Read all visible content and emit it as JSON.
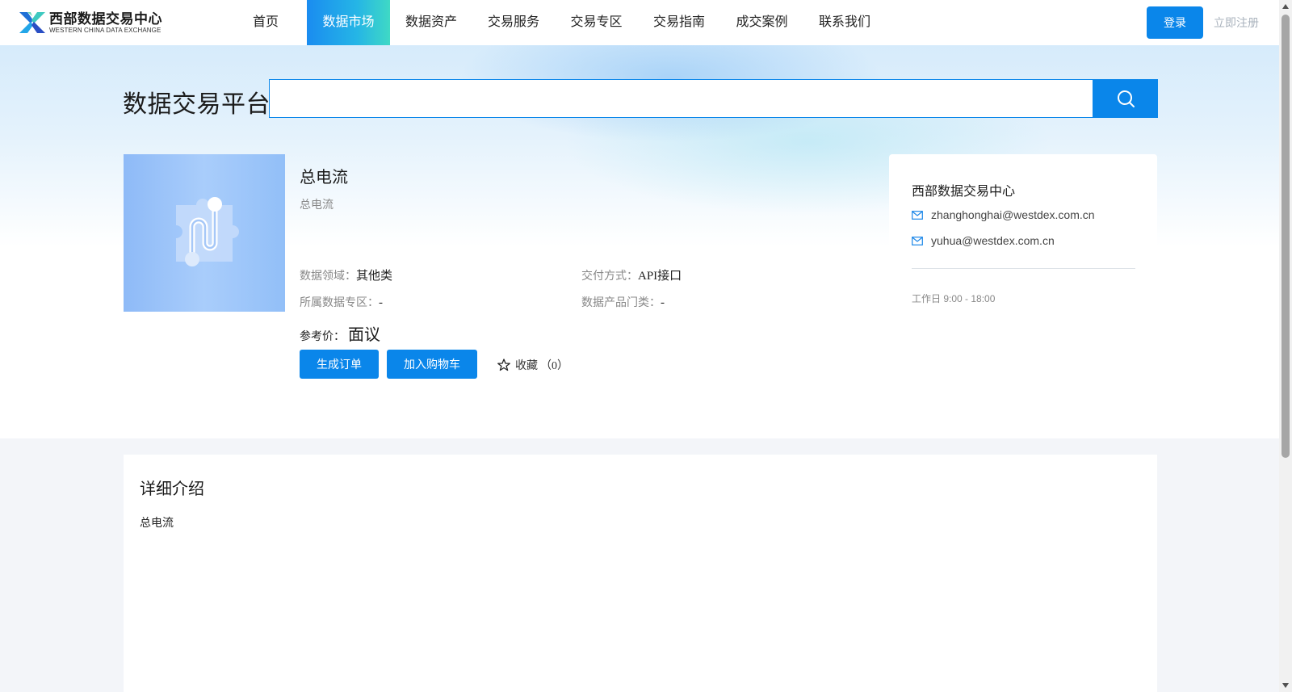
{
  "header": {
    "logo_cn": "西部数据交易中心",
    "logo_en": "WESTERN CHINA DATA EXCHANGE",
    "nav": [
      {
        "label": "首页",
        "active": false
      },
      {
        "label": "数据市场",
        "active": true
      },
      {
        "label": "数据资产",
        "active": false
      },
      {
        "label": "交易服务",
        "active": false
      },
      {
        "label": "交易专区",
        "active": false
      },
      {
        "label": "交易指南",
        "active": false
      },
      {
        "label": "成交案例",
        "active": false
      },
      {
        "label": "联系我们",
        "active": false
      }
    ],
    "login_label": "登录",
    "register_label": "立即注册"
  },
  "search": {
    "title": "数据交易平台",
    "value": "",
    "placeholder": ""
  },
  "product": {
    "title": "总电流",
    "subtitle": "总电流",
    "domain_label": "数据领域：",
    "domain_value": "其他类",
    "delivery_label": "交付方式：",
    "delivery_value": "API接口",
    "zone_label": "所属数据专区：",
    "zone_value": "-",
    "category_label": "数据产品门类：",
    "category_value": "-",
    "price_label": "参考价：",
    "price_value": "面议",
    "order_button": "生成订单",
    "cart_button": "加入购物车",
    "favorite_label": "收藏",
    "favorite_count": "（0）"
  },
  "contact": {
    "name": "西部数据交易中心",
    "emails": [
      "zhanghonghai@westdex.com.cn",
      "yuhua@westdex.com.cn"
    ],
    "hours": "工作日 9:00 - 18:00"
  },
  "detail": {
    "title": "详细介绍",
    "body": "总电流"
  },
  "colors": {
    "accent": "#0a86ea",
    "nav_active_start": "#1a8cf0",
    "nav_active_end": "#3fd9c5",
    "muted_text": "#888888"
  }
}
